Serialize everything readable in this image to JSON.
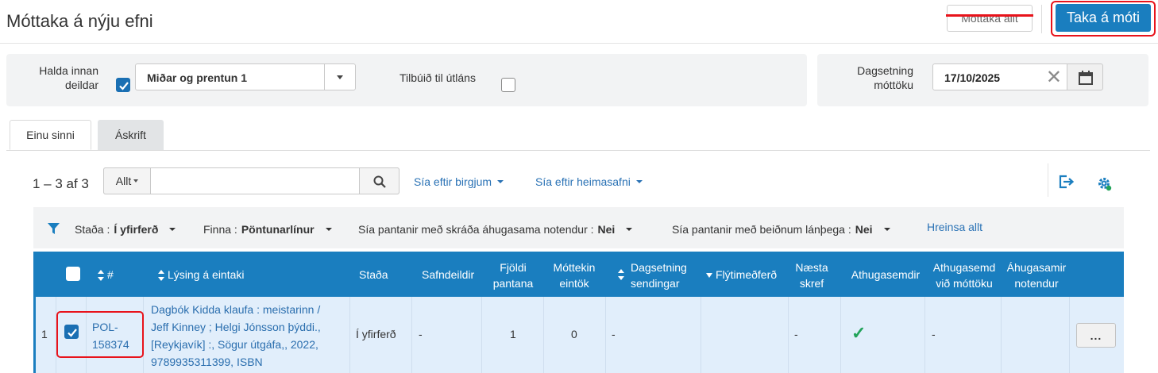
{
  "header": {
    "title": "Móttaka á nýju efni",
    "receive_all_label": "Móttaka allt",
    "receive_label": "Taka á móti"
  },
  "options": {
    "keep_in_dept_label_1": "Halda innan",
    "keep_in_dept_label_2": "deildar",
    "keep_in_dept_checked": true,
    "dept_select_value": "Miðar og prentun 1",
    "ready_for_loan_label": "Tilbúið til útláns",
    "ready_for_loan_checked": false,
    "receipt_date_label_1": "Dagsetning",
    "receipt_date_label_2": "móttöku",
    "receipt_date_value": "17/10/2025"
  },
  "tabs": [
    {
      "label": "Einu sinni",
      "active": true
    },
    {
      "label": "Áskrift",
      "active": false
    }
  ],
  "toolbar": {
    "count": "1 – 3 af 3",
    "search_scope": "Allt",
    "search_placeholder": "",
    "filter_vendor": "Sía eftir birgjum",
    "filter_library": "Sía eftir heimasafni",
    "export_icon": "export-icon",
    "settings_icon": "settings-gear-icon"
  },
  "facets": {
    "status_label": "Staða :",
    "status_value": "Í yfirferð",
    "find_label": "Finna :",
    "find_value": "Pöntunarlínur",
    "interested_label": "Sía pantanir með skráða áhugasama notendur :",
    "interested_value": "Nei",
    "patron_req_label": "Sía pantanir með beiðnum lánþega :",
    "patron_req_value": "Nei",
    "clear_all": "Hreinsa allt"
  },
  "table": {
    "columns": {
      "number": "#",
      "description": "Lýsing á eintaki",
      "status": "Staða",
      "library": "Safndeildir",
      "order_qty_1": "Fjöldi",
      "order_qty_2": "pantana",
      "received_1": "Móttekin",
      "received_2": "eintök",
      "ship_date_1": "Dagsetning",
      "ship_date_2": "sendingar",
      "rush": "Flýtimeðferð",
      "next_step_1": "Næsta",
      "next_step_2": "skref",
      "notes": "Athugasemdir",
      "receipt_note_1": "Athugasemd",
      "receipt_note_2": "við móttöku",
      "interested_1": "Áhugasamir",
      "interested_2": "notendur"
    },
    "rows": [
      {
        "index": "1",
        "checked": true,
        "po_line_1": "POL-",
        "po_line_2": "158374",
        "desc_1": "Dagbók Kidda klaufa : meistarinn /",
        "desc_2": "Jeff Kinney ; Helgi Jónsson þýddi.,",
        "desc_3": "[Reykjavík] :, Sögur útgáfa,, 2022,",
        "desc_4": "9789935311399, ISBN",
        "status": "Í yfirferð",
        "library": "-",
        "order_qty": "1",
        "received": "0",
        "ship_date": "-",
        "next_step": "-",
        "notes_mark": "✓",
        "receipt_note": "-",
        "more": "..."
      }
    ]
  },
  "colors": {
    "primary": "#1a7ebf",
    "highlight_red": "#e8131b",
    "link": "#2a72b5",
    "row_selected": "#e1eefb",
    "check_green": "#22a35a"
  }
}
